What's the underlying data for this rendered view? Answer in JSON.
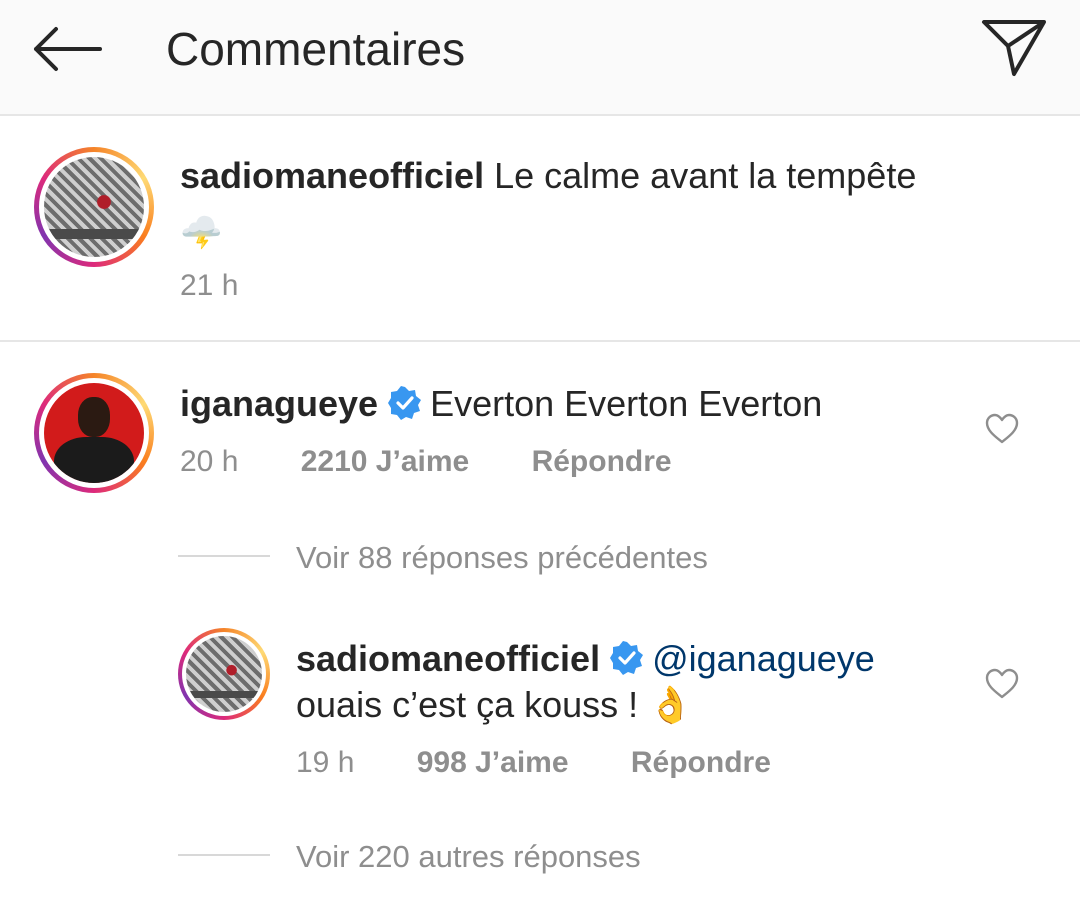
{
  "header": {
    "title": "Commentaires",
    "back_icon": "arrow-left-icon",
    "send_icon": "paper-plane-icon"
  },
  "caption": {
    "username": "sadiomaneofficiel",
    "text": "Le calme avant la tempête",
    "emoji": "🌩️",
    "time": "21 h"
  },
  "comments": [
    {
      "username": "iganagueye",
      "verified": true,
      "text": "Everton Everton Everton",
      "time": "20 h",
      "likes": "2210 J’aime",
      "reply_label": "Répondre",
      "view_previous_replies": "Voir 88 réponses précédentes",
      "reply": {
        "username": "sadiomaneofficiel",
        "verified": true,
        "mention": "@iganagueye",
        "text": "ouais c’est ça kouss !",
        "emoji": "👌",
        "time": "19 h",
        "likes": "998 J’aime",
        "reply_label": "Répondre"
      },
      "view_more_replies": "Voir 220 autres réponses"
    }
  ],
  "colors": {
    "text": "#262626",
    "secondary": "#8e8e8e",
    "verified": "#3897f0",
    "mention": "#00376b",
    "header_bg": "#fafafa"
  }
}
